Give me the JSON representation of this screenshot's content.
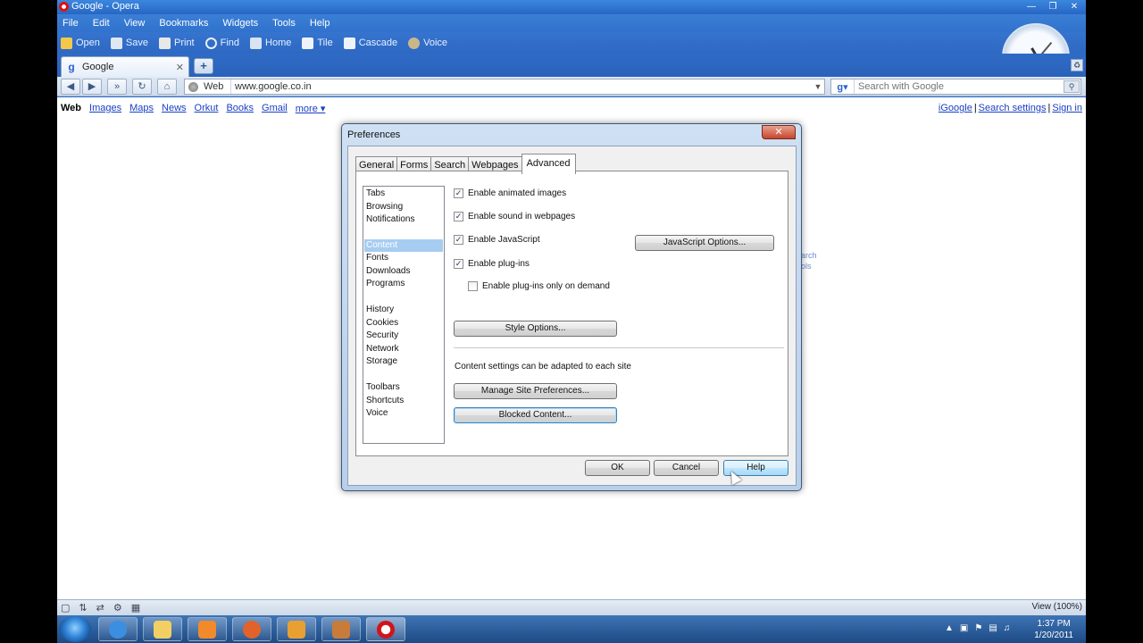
{
  "window": {
    "title": "Google - Opera",
    "controls": [
      "minimize",
      "restore",
      "close"
    ]
  },
  "menu": [
    "File",
    "Edit",
    "View",
    "Bookmarks",
    "Widgets",
    "Tools",
    "Help"
  ],
  "toolbar": [
    {
      "label": "Open",
      "icon": "folder-icon"
    },
    {
      "label": "Save",
      "icon": "save-icon"
    },
    {
      "label": "Print",
      "icon": "print-icon"
    },
    {
      "label": "Find",
      "icon": "find-icon"
    },
    {
      "label": "Home",
      "icon": "home-icon"
    },
    {
      "label": "Tile",
      "icon": "tile-icon"
    },
    {
      "label": "Cascade",
      "icon": "cascade-icon"
    },
    {
      "label": "Voice",
      "icon": "voice-icon"
    }
  ],
  "tabs": [
    {
      "label": "Google",
      "icon": "google-favicon"
    }
  ],
  "address": {
    "badge": "Web",
    "url": "www.google.co.in"
  },
  "search": {
    "placeholder": "Search with Google"
  },
  "page": {
    "gbar": [
      "Web",
      "Images",
      "Maps",
      "News",
      "Orkut",
      "Books",
      "Gmail",
      "more ▾"
    ],
    "gbar_right": [
      "iGoogle",
      "Search settings",
      "Sign in"
    ],
    "side_links": [
      "earch",
      "ools"
    ]
  },
  "dialog": {
    "title": "Preferences",
    "tabs": [
      "General",
      "Forms",
      "Search",
      "Webpages",
      "Advanced"
    ],
    "active_tab": "Advanced",
    "categories": [
      "Tabs",
      "Browsing",
      "Notifications",
      "Content",
      "Fonts",
      "Downloads",
      "Programs",
      "History",
      "Cookies",
      "Security",
      "Network",
      "Storage",
      "Toolbars",
      "Shortcuts",
      "Voice"
    ],
    "selected_category": "Content",
    "options": {
      "animated_images": {
        "label": "Enable animated images",
        "checked": true
      },
      "sound": {
        "label": "Enable sound in webpages",
        "checked": true
      },
      "javascript": {
        "label": "Enable JavaScript",
        "checked": true
      },
      "plugins": {
        "label": "Enable plug-ins",
        "checked": true
      },
      "plugins_on_demand": {
        "label": "Enable plug-ins only on demand",
        "checked": false
      }
    },
    "buttons": {
      "javascript_options": "JavaScript Options...",
      "style_options": "Style Options...",
      "manage_site": "Manage Site Preferences...",
      "blocked_content": "Blocked Content...",
      "ok": "OK",
      "cancel": "Cancel",
      "help": "Help"
    },
    "info_text": "Content settings can be adapted to each site"
  },
  "statusbar": {
    "zoom": "View (100%)"
  },
  "taskbar": {
    "time": "1:37 PM",
    "date": "1/20/2011"
  },
  "colors": {
    "title_blue": "#2766c4",
    "selection": "#a7ccf2",
    "link": "#1a3fc4"
  }
}
